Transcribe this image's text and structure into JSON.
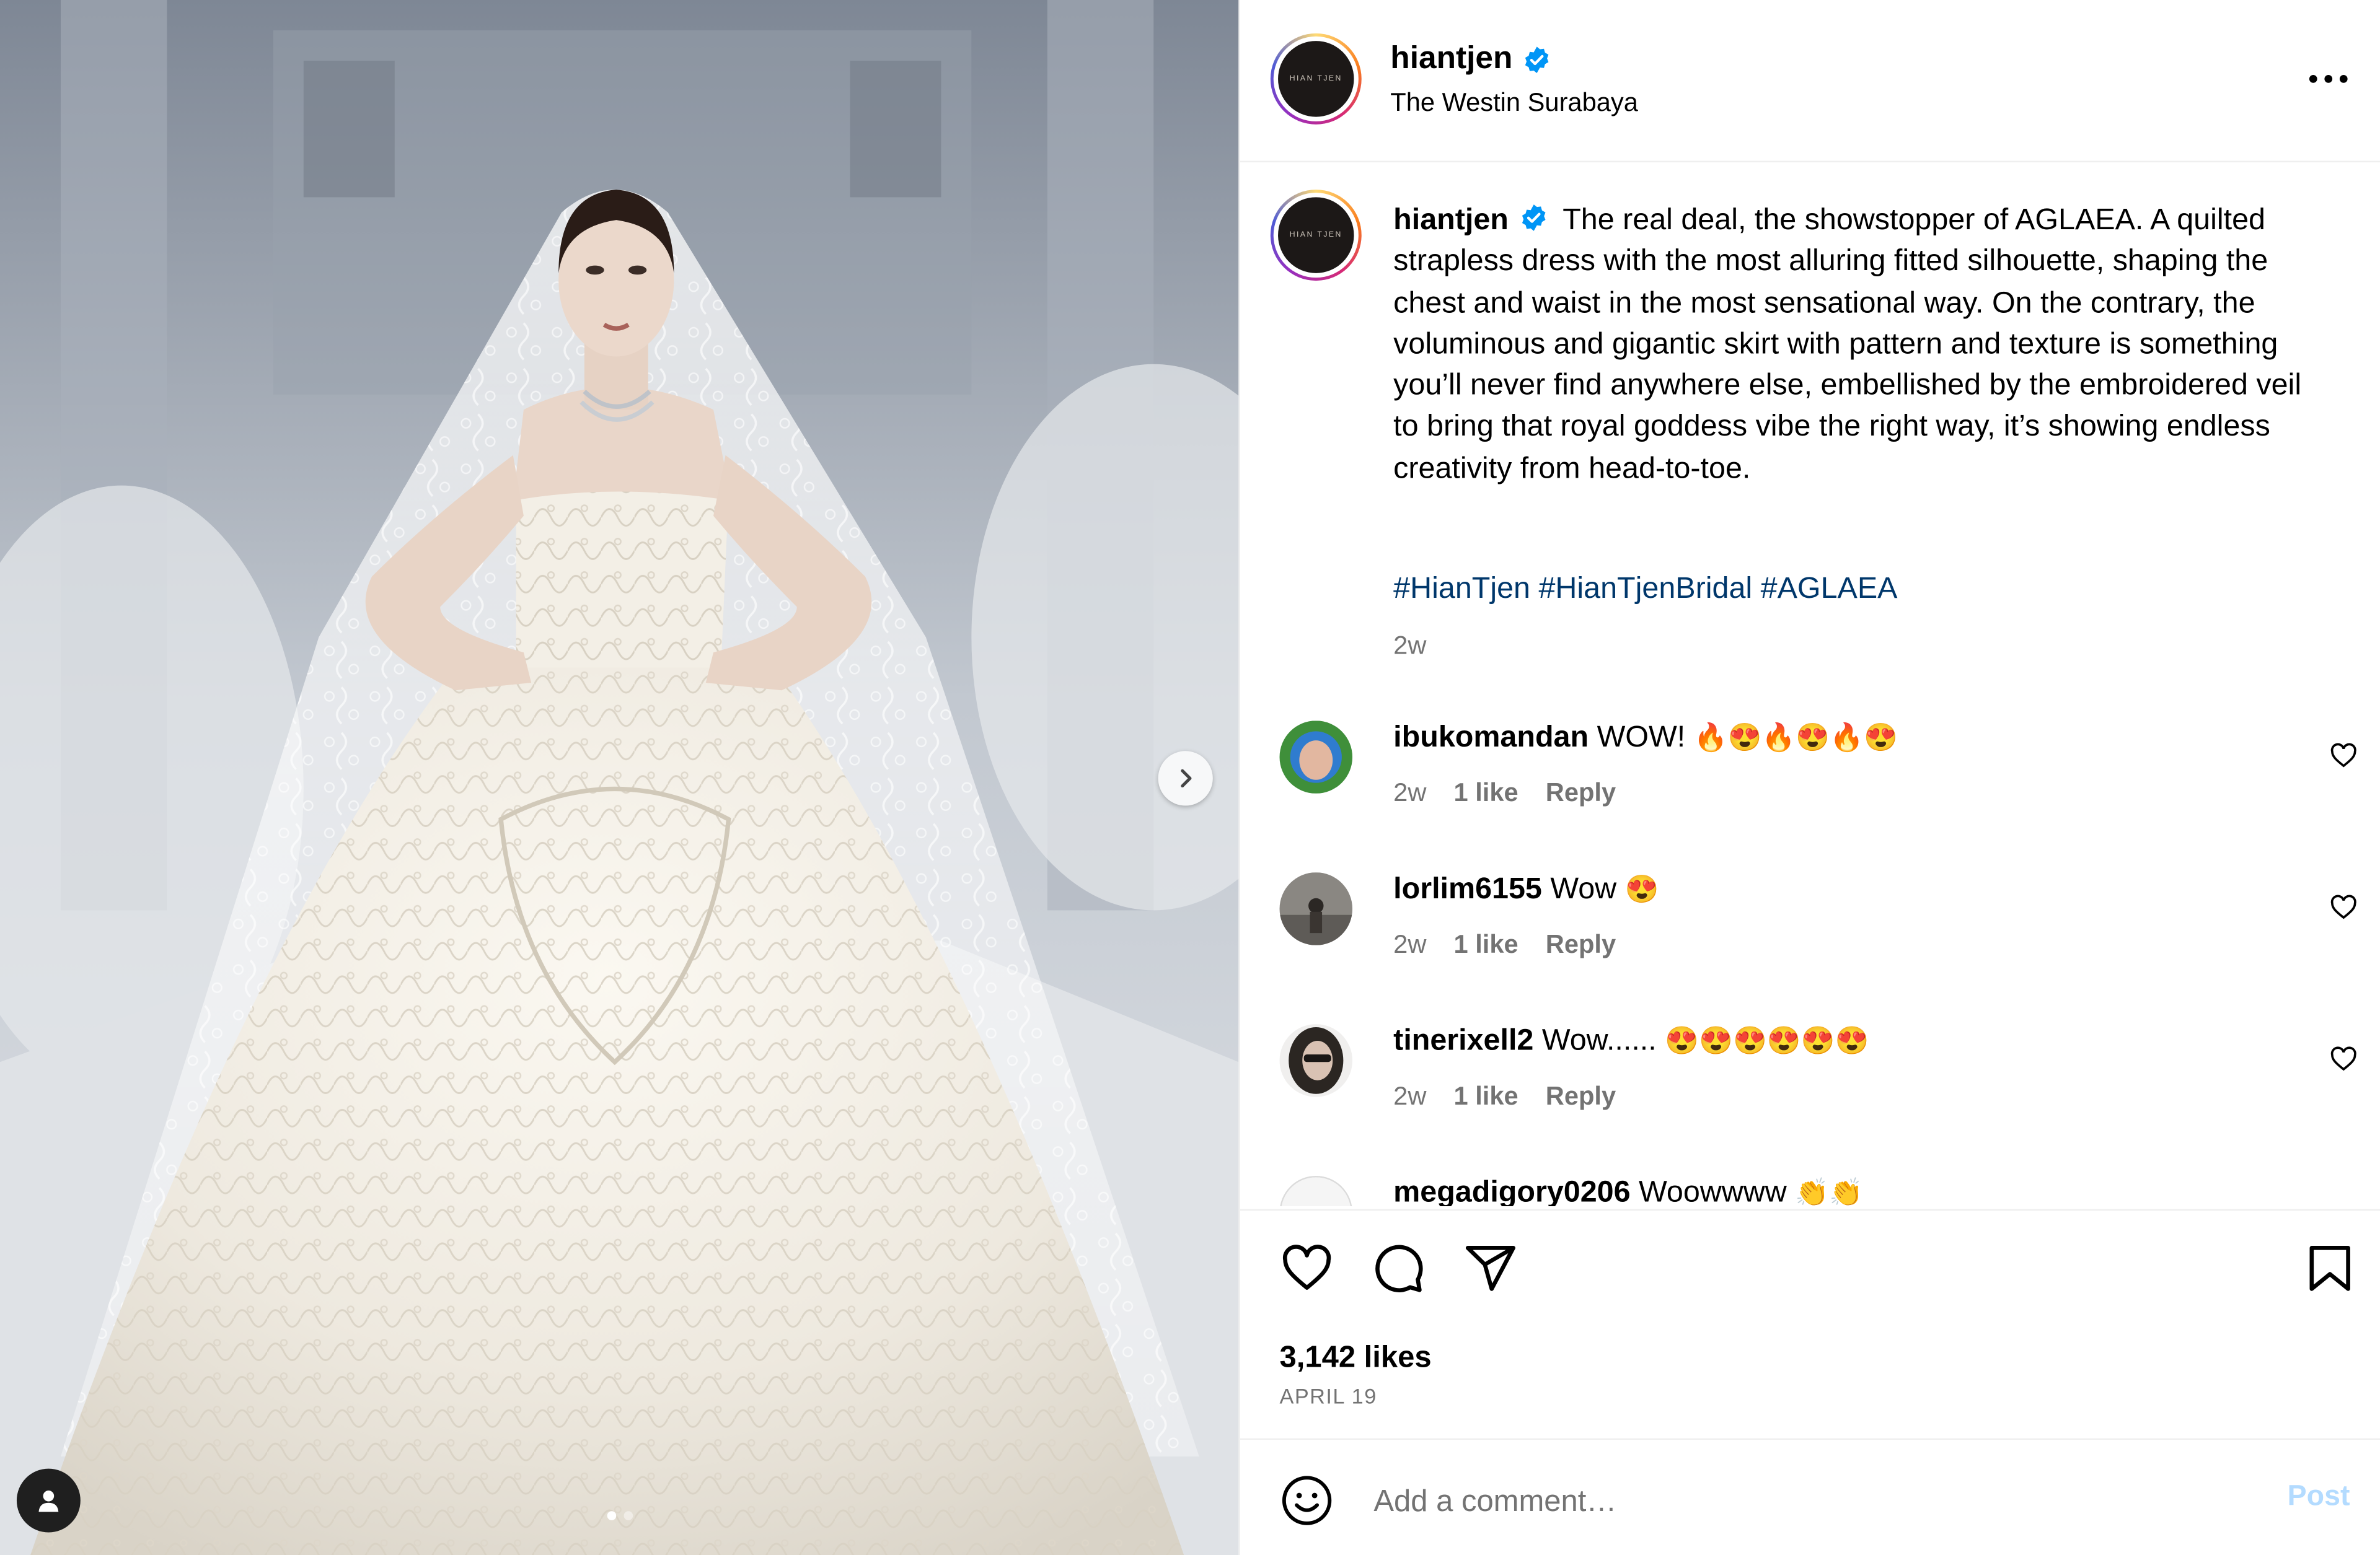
{
  "post": {
    "username": "hiantjen",
    "location": "The Westin Surabaya",
    "logo_text": "HIAN TJEN",
    "caption": "The real deal, the showstopper of AGLAEA. A quilted strapless dress with the most alluring fitted silhouette, shaping the chest and waist in the most sensational way. On the contrary, the voluminous and gigantic skirt with pattern and texture is something you’ll never find anywhere else, embellished by the embroidered veil to bring that royal goddess vibe the right way, it’s showing endless creativity from head-to-toe.",
    "hashtags": [
      "#HianTjen",
      "#HianTjenBridal",
      "#AGLAEA"
    ],
    "time_ago": "2w",
    "likes": "3,142 likes",
    "date": "APRIL 19",
    "carousel": {
      "count": 2,
      "active_index": 0
    }
  },
  "comments": [
    {
      "username": "ibukomandan",
      "text": "WOW!",
      "emoji": "🔥😍🔥😍🔥😍",
      "time": "2w",
      "likes": "1 like",
      "reply": "Reply",
      "avatar_color": "#3f8f3a"
    },
    {
      "username": "lorlim6155",
      "text": "Wow",
      "emoji": "😍",
      "time": "2w",
      "likes": "1 like",
      "reply": "Reply",
      "avatar_color": "#6d6a66"
    },
    {
      "username": "tinerixell2",
      "text": "Wow......",
      "emoji": "😍😍😍😍😍😍",
      "time": "2w",
      "likes": "1 like",
      "reply": "Reply",
      "avatar_color": "#2b2622"
    },
    {
      "username": "megadigory0206",
      "text": "Woowwww",
      "emoji": "👏👏",
      "time": "",
      "likes": "",
      "reply": "",
      "avatar_color": "#e5e5e5"
    }
  ],
  "add_comment": {
    "placeholder": "Add a comment…",
    "post_label": "Post"
  },
  "colors": {
    "verified": "#0095f6",
    "hashtag": "#00376b",
    "muted": "#737373",
    "post_disabled": "#b3dbff"
  },
  "icons": [
    "chevron-right-icon",
    "user-tag-icon",
    "more-icon",
    "verified-icon",
    "heart-icon",
    "comment-icon",
    "share-icon",
    "bookmark-icon",
    "emoji-icon"
  ]
}
